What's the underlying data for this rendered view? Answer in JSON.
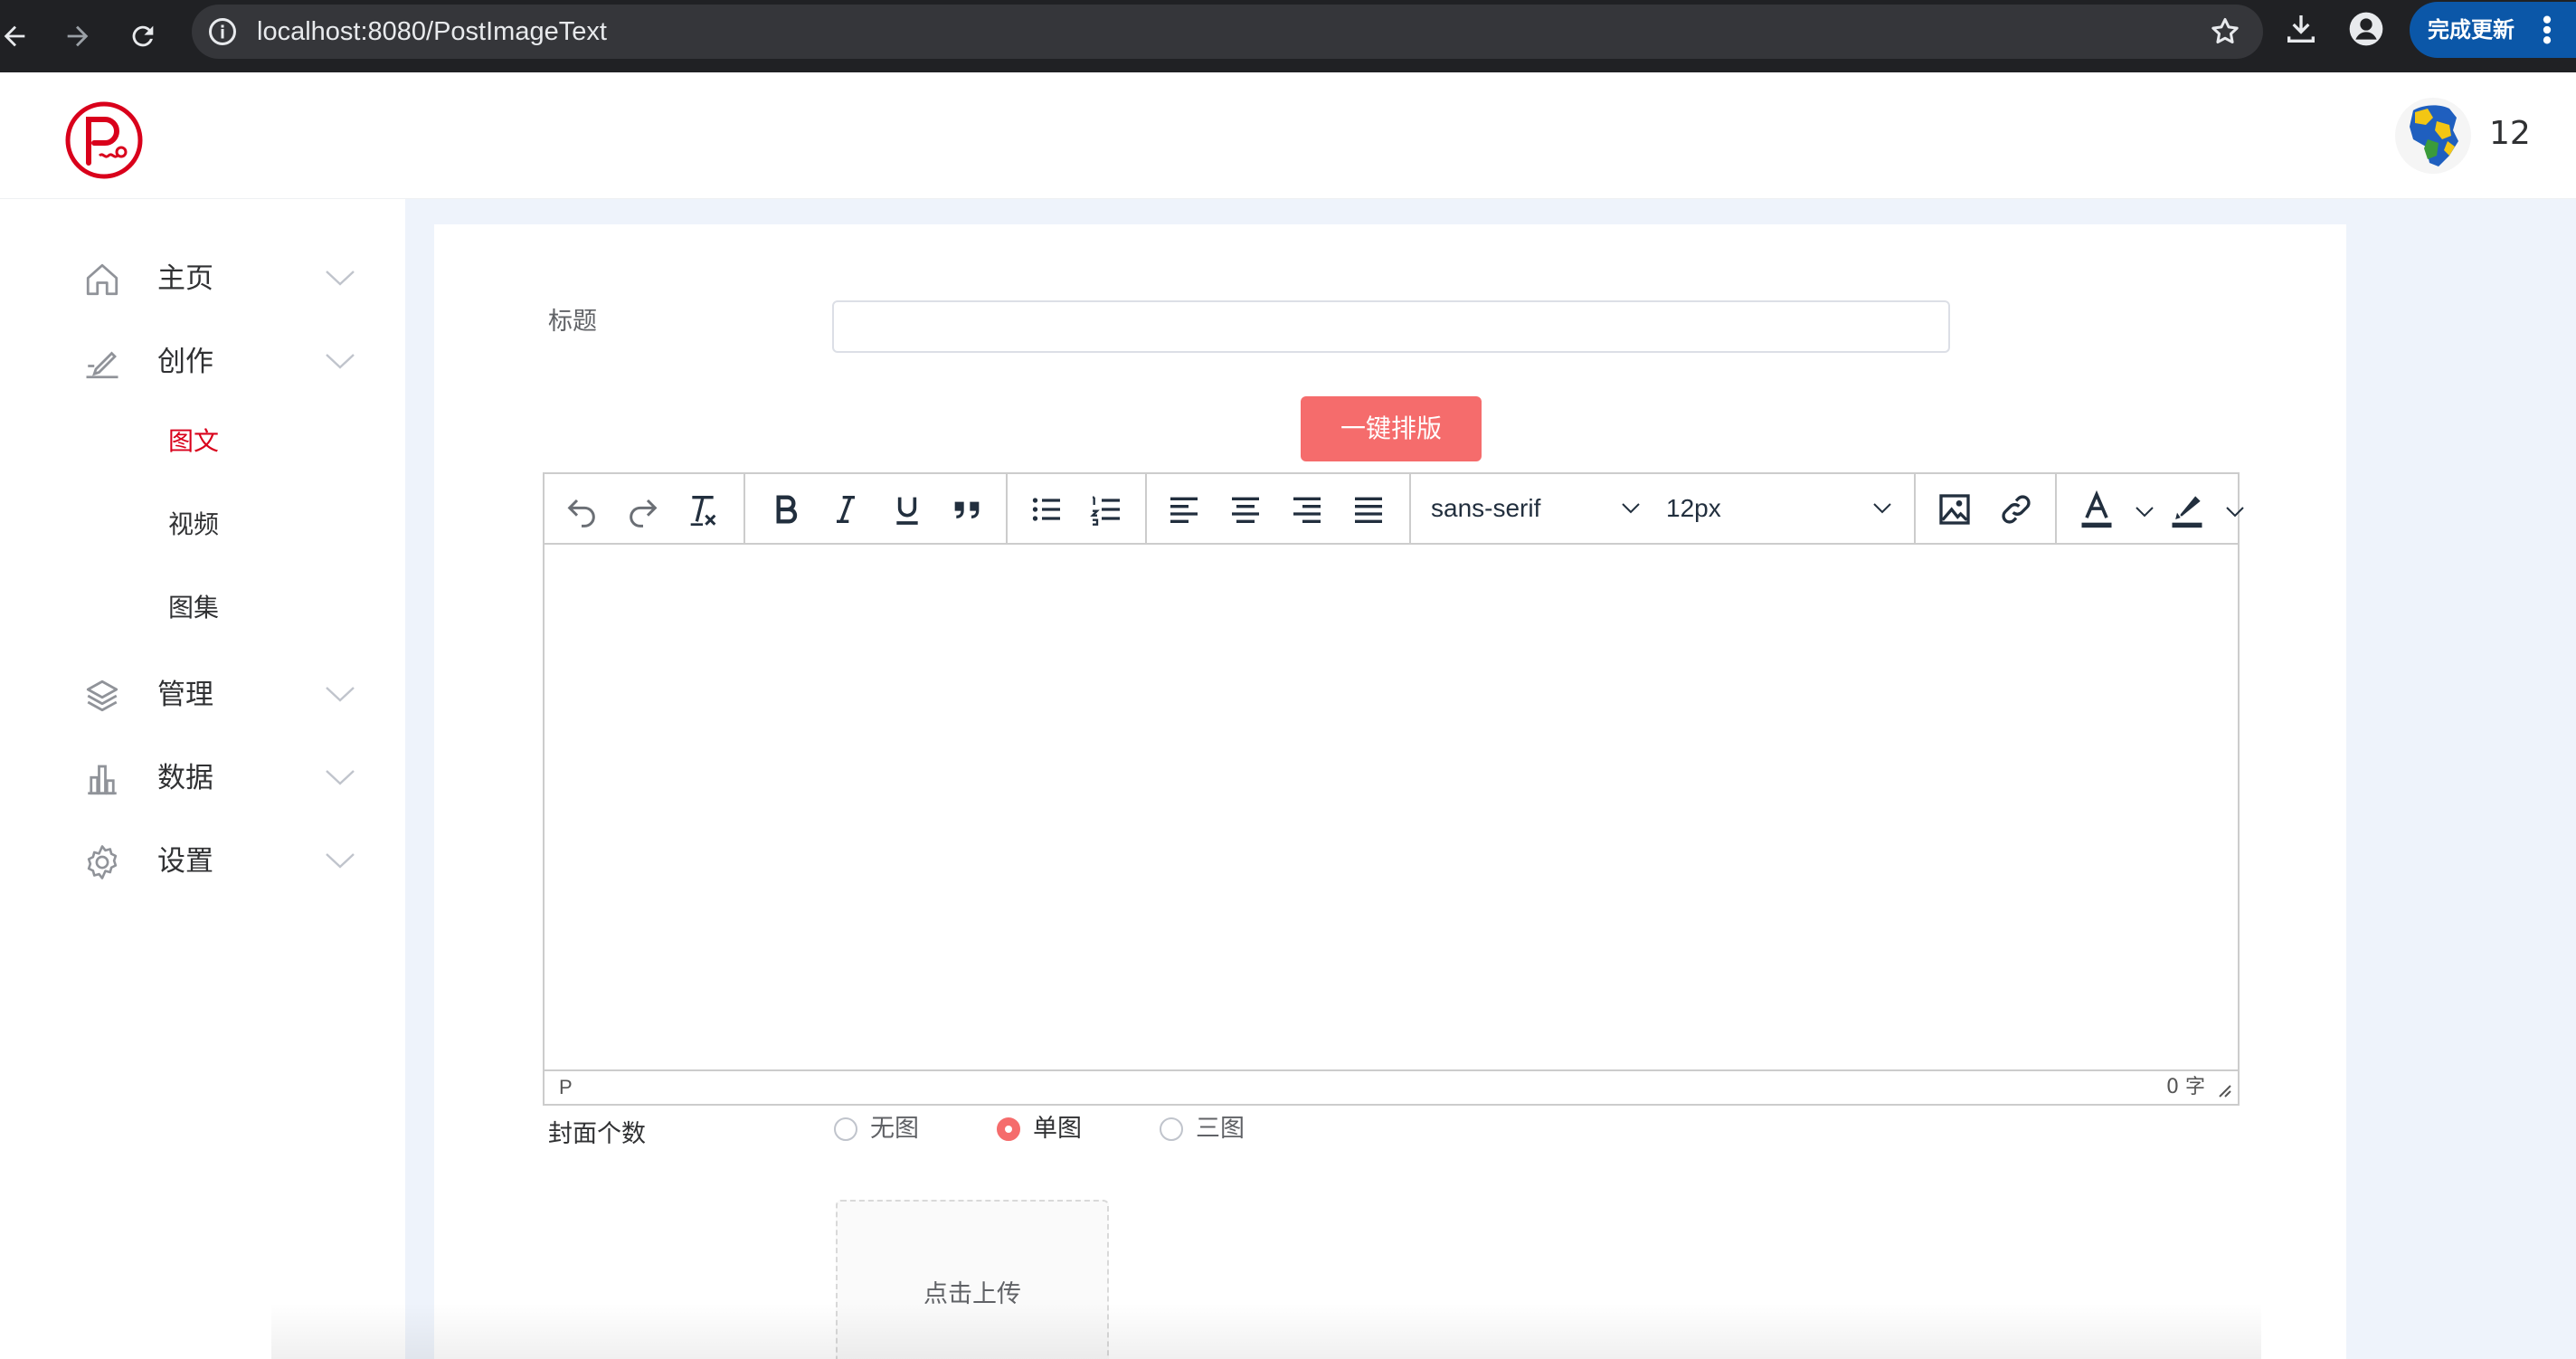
{
  "browser": {
    "url": "localhost:8080/PostImageText",
    "update_label": "完成更新",
    "icons": [
      "back-icon",
      "forward-icon",
      "reload-icon",
      "info-icon",
      "star-icon",
      "download-icon",
      "profile-icon",
      "more-vert-icon"
    ]
  },
  "header": {
    "username": "12",
    "brand_color": "#d9001b"
  },
  "sidebar": {
    "items": [
      {
        "label": "主页",
        "icon": "home-icon"
      },
      {
        "label": "创作",
        "icon": "pen-icon"
      },
      {
        "label": "管理",
        "icon": "layers-icon"
      },
      {
        "label": "数据",
        "icon": "bar-chart-icon"
      },
      {
        "label": "设置",
        "icon": "gear-icon"
      }
    ],
    "sub_items": [
      {
        "label": "图文",
        "active": true
      },
      {
        "label": "视频",
        "active": false
      },
      {
        "label": "图集",
        "active": false
      }
    ]
  },
  "form": {
    "title_label": "标题",
    "title_value": "",
    "format_button": "一键排版",
    "cover_label": "封面个数",
    "cover_options": [
      {
        "label": "无图",
        "checked": false
      },
      {
        "label": "单图",
        "checked": true
      },
      {
        "label": "三图",
        "checked": false
      }
    ],
    "upload_label": "点击上传",
    "accent_color": "#f56c6c"
  },
  "editor": {
    "font_family": "sans-serif",
    "font_size": "12px",
    "status_path": "P",
    "word_count": "0 字"
  }
}
